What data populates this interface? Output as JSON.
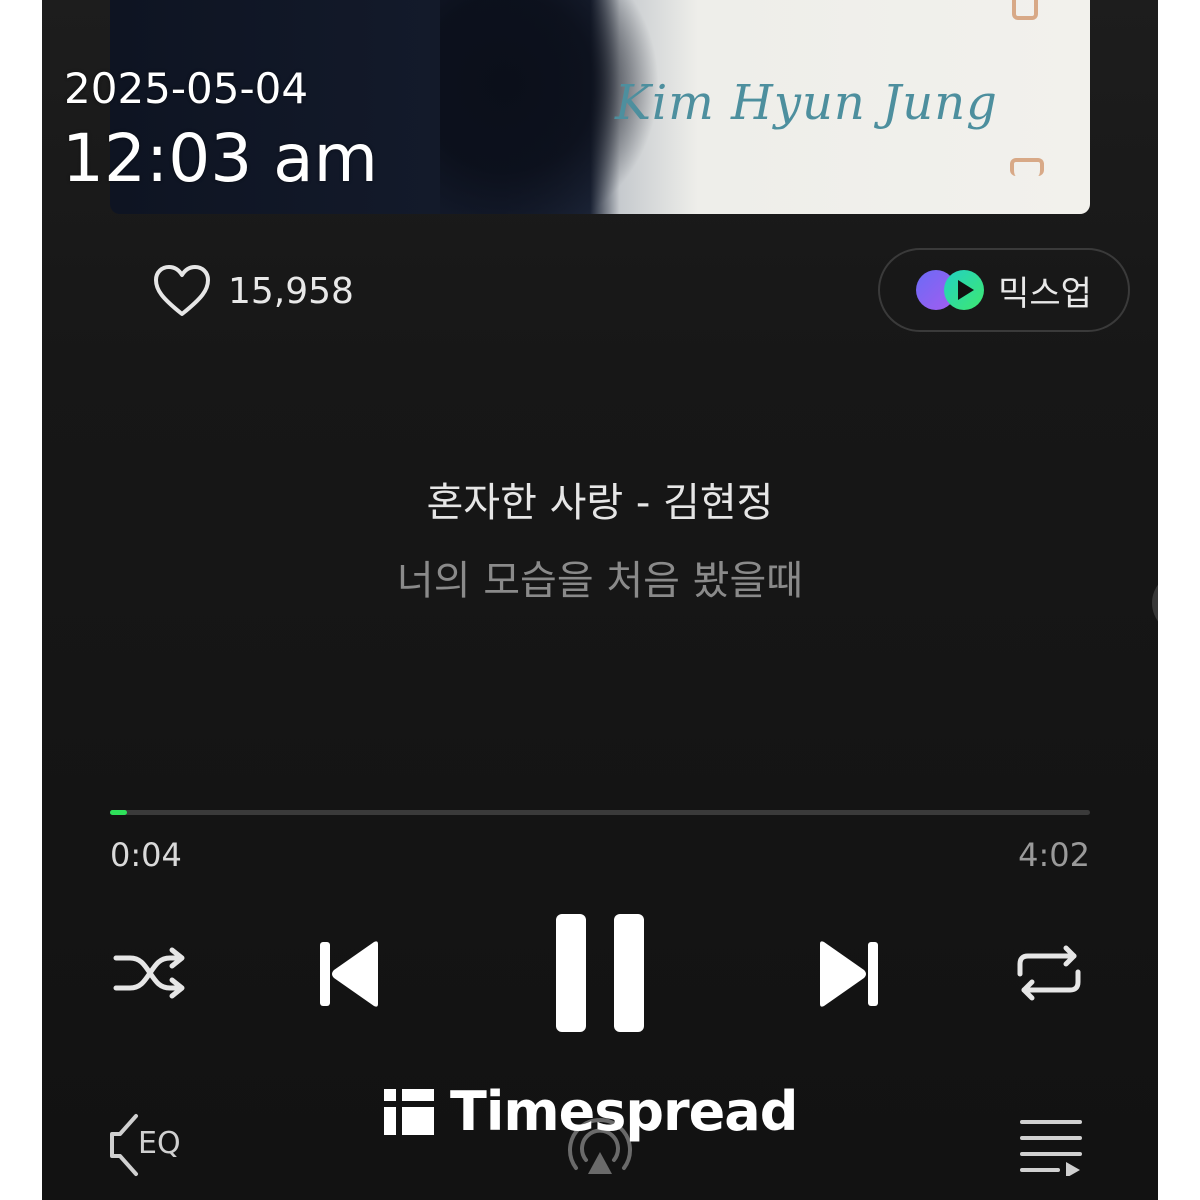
{
  "album": {
    "artist_script": "Kim Hyun Jung"
  },
  "overlay": {
    "date": "2025-05-04",
    "time": "12:03 am"
  },
  "like": {
    "count": "15,958",
    "icon": "heart-icon"
  },
  "mixup": {
    "label": "믹스업",
    "icon": "mixup-icon"
  },
  "song": {
    "title": "혼자한 사랑 - 김현정",
    "lyric_line": "너의 모습을 처음 봤을때"
  },
  "playback": {
    "current_time": "0:04",
    "total_time": "4:02",
    "progress_fraction": 0.017,
    "progress_color": "#2ee05a"
  },
  "controls": {
    "shuffle_icon": "shuffle-icon",
    "previous_icon": "skip-previous-icon",
    "pause_icon": "pause-icon",
    "next_icon": "skip-next-icon",
    "repeat_icon": "repeat-icon"
  },
  "bottom_bar": {
    "eq_label": "EQ",
    "cast_icon": "cast-icon",
    "queue_icon": "playlist-icon"
  },
  "watermark": {
    "text": "Timespread"
  },
  "scroll": {
    "thumb_color": "#1f78c8"
  }
}
